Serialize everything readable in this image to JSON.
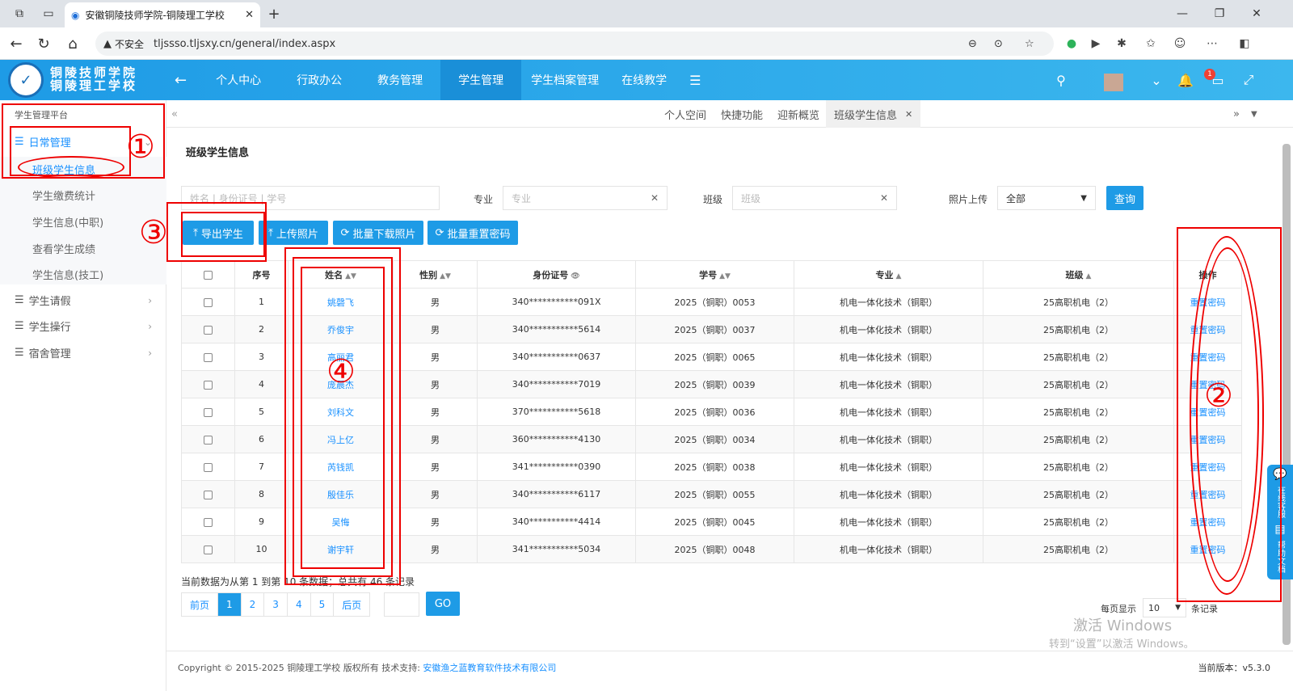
{
  "browser": {
    "tab_title": "安徽铜陵技师学院-铜陵理工学校",
    "security_label": "不安全",
    "url": "tljssso.tljsxy.cn/general/index.aspx"
  },
  "header": {
    "logo_line1": "铜陵技师学院",
    "logo_line2": "铜陵理工学校",
    "nav": [
      "个人中心",
      "行政办公",
      "教务管理",
      "学生管理",
      "学生档案管理",
      "在线教学"
    ],
    "active_nav": "学生管理",
    "notification_count": "1"
  },
  "sidebar": {
    "title": "学生管理平台",
    "groups": [
      {
        "label": "日常管理",
        "items": [
          "班级学生信息",
          "学生缴费统计",
          "学生信息(中职)",
          "查看学生成绩",
          "学生信息(技工)"
        ]
      },
      {
        "label": "学生请假"
      },
      {
        "label": "学生操行"
      },
      {
        "label": "宿舍管理"
      }
    ],
    "active_item": "班级学生信息"
  },
  "content_tabs": [
    "个人空间",
    "快捷功能",
    "迎新概览",
    "班级学生信息"
  ],
  "page": {
    "title": "班级学生信息",
    "search_placeholder": "姓名 | 身份证号 | 学号",
    "major_label": "专业",
    "major_placeholder": "专业",
    "class_label": "班级",
    "class_placeholder": "班级",
    "photo_label": "照片上传",
    "photo_value": "全部",
    "query_button": "查询",
    "buttons": [
      "导出学生",
      "上传照片",
      "批量下载照片",
      "批量重置密码"
    ]
  },
  "table": {
    "headers": [
      "序号",
      "姓名",
      "性别",
      "身份证号",
      "学号",
      "专业",
      "班级",
      "操作"
    ],
    "rows": [
      {
        "no": "1",
        "name": "姚磬飞",
        "gender": "男",
        "id": "340***********091X",
        "sid": "2025（铜职）0053",
        "major": "机电一体化技术（铜职）",
        "class": "25高职机电（2）",
        "op": "重置密码"
      },
      {
        "no": "2",
        "name": "乔俊宇",
        "gender": "男",
        "id": "340***********5614",
        "sid": "2025（铜职）0037",
        "major": "机电一体化技术（铜职）",
        "class": "25高职机电（2）",
        "op": "重置密码"
      },
      {
        "no": "3",
        "name": "高丽君",
        "gender": "男",
        "id": "340***********0637",
        "sid": "2025（铜职）0065",
        "major": "机电一体化技术（铜职）",
        "class": "25高职机电（2）",
        "op": "重置密码"
      },
      {
        "no": "4",
        "name": "庞晨杰",
        "gender": "男",
        "id": "340***********7019",
        "sid": "2025（铜职）0039",
        "major": "机电一体化技术（铜职）",
        "class": "25高职机电（2）",
        "op": "重置密码"
      },
      {
        "no": "5",
        "name": "刘科文",
        "gender": "男",
        "id": "370***********5618",
        "sid": "2025（铜职）0036",
        "major": "机电一体化技术（铜职）",
        "class": "25高职机电（2）",
        "op": "重置密码"
      },
      {
        "no": "6",
        "name": "冯上亿",
        "gender": "男",
        "id": "360***********4130",
        "sid": "2025（铜职）0034",
        "major": "机电一体化技术（铜职）",
        "class": "25高职机电（2）",
        "op": "重置密码"
      },
      {
        "no": "7",
        "name": "芮钱凯",
        "gender": "男",
        "id": "341***********0390",
        "sid": "2025（铜职）0038",
        "major": "机电一体化技术（铜职）",
        "class": "25高职机电（2）",
        "op": "重置密码"
      },
      {
        "no": "8",
        "name": "殷佳乐",
        "gender": "男",
        "id": "340***********6117",
        "sid": "2025（铜职）0055",
        "major": "机电一体化技术（铜职）",
        "class": "25高职机电（2）",
        "op": "重置密码"
      },
      {
        "no": "9",
        "name": "吴悔",
        "gender": "男",
        "id": "340***********4414",
        "sid": "2025（铜职）0045",
        "major": "机电一体化技术（铜职）",
        "class": "25高职机电（2）",
        "op": "重置密码"
      },
      {
        "no": "10",
        "name": "谢宇轩",
        "gender": "男",
        "id": "341***********5034",
        "sid": "2025（铜职）0048",
        "major": "机电一体化技术（铜职）",
        "class": "25高职机电（2）",
        "op": "重置密码"
      }
    ]
  },
  "pagination": {
    "summary": "当前数据为从第 1 到第 10 条数据；总共有 46 条记录",
    "prev": "前页",
    "pages": [
      "1",
      "2",
      "3",
      "4",
      "5"
    ],
    "next": "后页",
    "go": "GO",
    "per_page_label": "每页显示",
    "per_page_value": "10",
    "per_page_unit": "条记录"
  },
  "footer": {
    "copyright": "Copyright © 2015-2025  铜陵理工学校 版权所有  技术支持:",
    "support_link": "安徽渔之蓝教育软件技术有限公司",
    "version": "当前版本：v5.3.0"
  },
  "float_help": [
    "在线客服",
    "帮助文档"
  ],
  "watermark": {
    "line1": "激活 Windows",
    "line2": "转到“设置”以激活 Windows。"
  },
  "annotations": [
    "①",
    "②",
    "③",
    "④"
  ],
  "colors": {
    "primary": "#1e9be6",
    "link": "#1890ff",
    "annotation": "#ee0000"
  }
}
